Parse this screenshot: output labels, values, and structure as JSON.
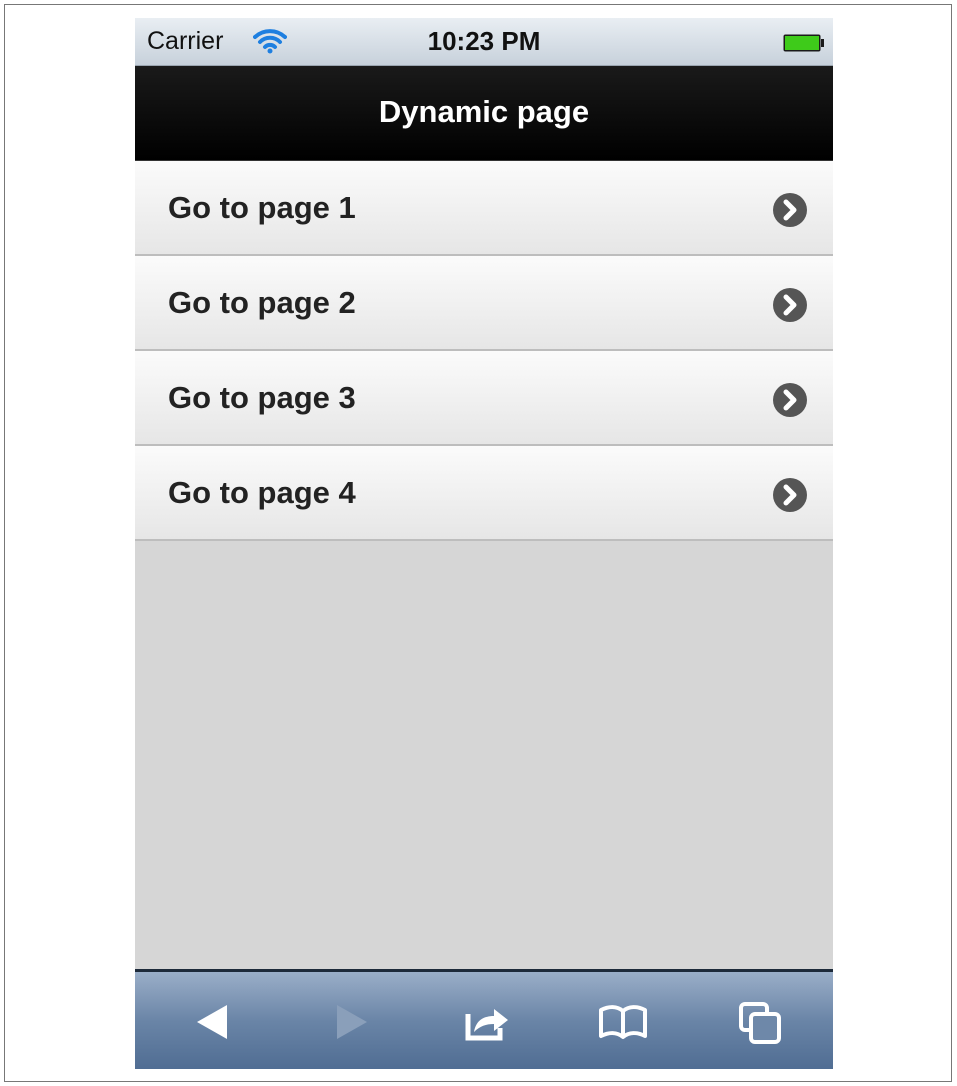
{
  "status_bar": {
    "carrier": "Carrier",
    "time": "10:23 PM",
    "wifi_icon": "wifi-icon",
    "battery_icon": "battery-icon",
    "battery_color": "#3ecb1a"
  },
  "header": {
    "title": "Dynamic page"
  },
  "list": {
    "items": [
      {
        "label": "Go to page 1",
        "icon": "chevron-right-icon"
      },
      {
        "label": "Go to page 2",
        "icon": "chevron-right-icon"
      },
      {
        "label": "Go to page 3",
        "icon": "chevron-right-icon"
      },
      {
        "label": "Go to page 4",
        "icon": "chevron-right-icon"
      }
    ]
  },
  "toolbar": {
    "buttons": [
      {
        "icon": "back-arrow-icon",
        "enabled": true
      },
      {
        "icon": "forward-arrow-icon",
        "enabled": false
      },
      {
        "icon": "share-icon",
        "enabled": true
      },
      {
        "icon": "bookmarks-icon",
        "enabled": true
      },
      {
        "icon": "tabs-icon",
        "enabled": true
      }
    ]
  },
  "colors": {
    "header_bg": "#000000",
    "list_bg": "#d6d6d6",
    "chevron": "#555555",
    "toolbar": "#6a85a7",
    "wifi": "#1e7fe0"
  }
}
